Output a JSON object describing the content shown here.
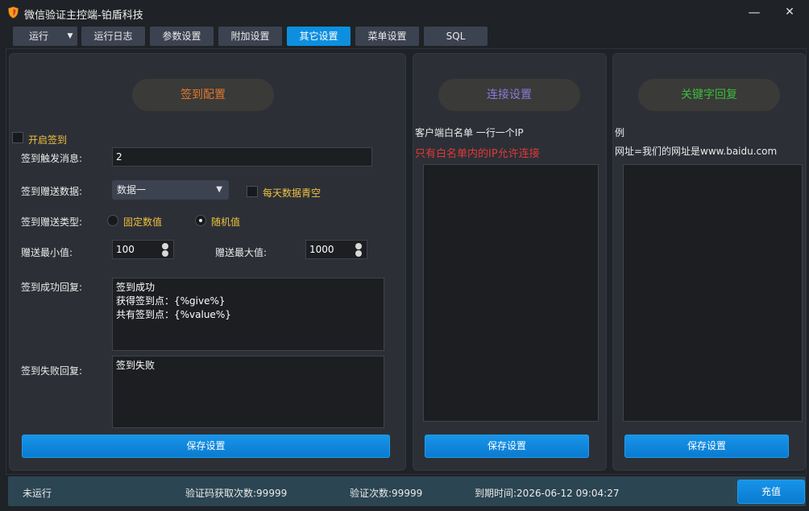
{
  "window": {
    "title": "微信验证主控端-铂盾科技",
    "minimize": "—",
    "close": "✕"
  },
  "tabs": [
    {
      "label": "运行"
    },
    {
      "label": "运行日志"
    },
    {
      "label": "参数设置"
    },
    {
      "label": "附加设置"
    },
    {
      "label": "其它设置"
    },
    {
      "label": "菜单设置"
    },
    {
      "label": "SQL"
    }
  ],
  "active_tab": "其它设置",
  "checkin": {
    "section_title": "签到配置",
    "enable_label": "开启签到",
    "enabled": false,
    "trigger_label": "签到触发消息:",
    "trigger_value": "2",
    "data_label": "签到赠送数据:",
    "data_selected": "数据一",
    "daily_clear_label": "每天数据青空",
    "daily_clear": false,
    "type_label": "签到赠送类型:",
    "type_options": [
      "固定数值",
      "随机值"
    ],
    "type_selected": "随机值",
    "min_label": "赠送最小值:",
    "min_value": "100",
    "max_label": "赠送最大值:",
    "max_value": "1000",
    "success_label": "签到成功回复:",
    "success_reply": "签到成功\n获得签到点：{%give%}\n共有签到点：{%value%}",
    "fail_label": "签到失败回复:",
    "fail_reply": "签到失败",
    "save_label": "保存设置"
  },
  "connection": {
    "section_title": "连接设置",
    "whitelist_label": "客户端白名单 一行一个IP",
    "whitelist_note": "只有白名单内的IP允许连接",
    "save_label": "保存设置"
  },
  "keyword": {
    "section_title": "关键字回复",
    "example_label": "例",
    "example_text": "网址=我们的网址是www.baidu.com",
    "save_label": "保存设置"
  },
  "status": {
    "state": "未运行",
    "code_fetch": "验证码获取次数:99999",
    "verify_count": "验证次数:99999",
    "expiry": "到期时间:2026-06-12 09:04:27",
    "recharge_label": "充值"
  },
  "colors": {
    "accent": "#0d8fe0",
    "checkin_title": "#e0782a",
    "connection_title": "#8a7bd8",
    "keyword_title": "#3bbd3b",
    "warning_text": "#e03838",
    "option_text": "#f0c040"
  },
  "icons": {
    "app": "shield-icon",
    "dropdown": "chevron-down-icon"
  }
}
